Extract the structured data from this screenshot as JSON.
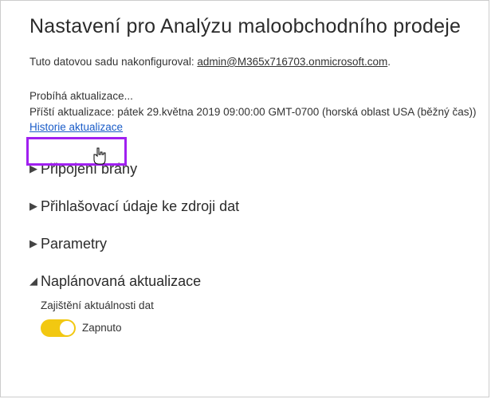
{
  "title": "Nastavení pro Analýzu maloobchodního prodeje",
  "config_line": {
    "prefix": "Tuto datovou sadu nakonfiguroval: ",
    "admin": "admin@M365x716703.onmicrosoft.com",
    "suffix": "."
  },
  "status": {
    "in_progress": "Probíhá aktualizace...",
    "next_refresh": "Příští aktualizace: pátek 29.května 2019 09:00:00 GMT-0700 (horská oblast USA (běžný čas))",
    "history_link": "Historie aktualizace"
  },
  "sections": {
    "gateway": "Připojení brány",
    "credentials": "Přihlašovací údaje ke zdroji dat",
    "parameters": "Parametry",
    "scheduled": "Naplánovaná aktualizace"
  },
  "scheduled": {
    "keep_data_label": "Zajištění aktuálnosti dat",
    "toggle_state": "Zapnuto"
  },
  "carets": {
    "collapsed": "▶",
    "expanded": "◢"
  }
}
